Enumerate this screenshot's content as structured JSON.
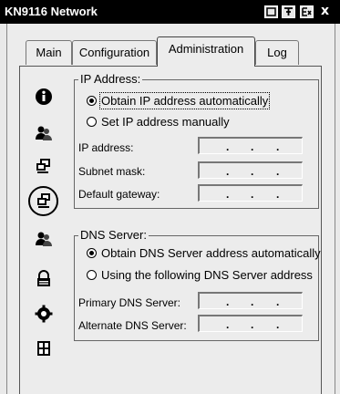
{
  "window": {
    "title": "KN9116 Network",
    "close_glyph": "x"
  },
  "tabs": [
    {
      "label": "Main",
      "active": false
    },
    {
      "label": "Configuration",
      "active": false
    },
    {
      "label": "Administration",
      "active": true
    },
    {
      "label": "Log",
      "active": false
    }
  ],
  "sidebar": {
    "icons": [
      "info-icon",
      "users-icon",
      "computers-icon",
      "network-icon",
      "users-group-icon",
      "lock-icon",
      "gear-icon",
      "device-icon"
    ],
    "selected": "network-icon"
  },
  "ip_address": {
    "group_title": "IP Address:",
    "options": [
      {
        "label": "Obtain IP address automatically",
        "selected": true
      },
      {
        "label": "Set IP address manually",
        "selected": false
      }
    ],
    "fields": [
      {
        "label": "IP address:",
        "value": ". . ."
      },
      {
        "label": "Subnet mask:",
        "value": ". . ."
      },
      {
        "label": "Default gateway:",
        "value": ". . ."
      }
    ]
  },
  "dns_server": {
    "group_title": "DNS Server:",
    "options": [
      {
        "label": "Obtain DNS Server address automatically",
        "selected": true
      },
      {
        "label": "Using the following DNS Server address",
        "selected": false
      }
    ],
    "fields": [
      {
        "label": "Primary DNS Server:",
        "value": ". . ."
      },
      {
        "label": "Alternate DNS Server:",
        "value": ". . ."
      }
    ]
  }
}
